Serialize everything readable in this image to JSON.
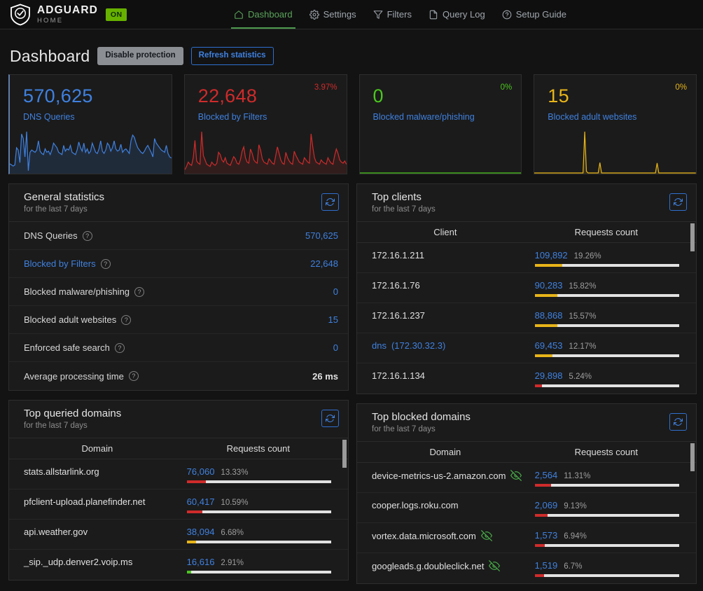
{
  "header": {
    "brand_name": "ADGUARD",
    "brand_sub": "HOME",
    "status_badge": "ON",
    "nav": [
      {
        "label": "Dashboard",
        "icon": "home-icon",
        "active": true
      },
      {
        "label": "Settings",
        "icon": "gear-icon",
        "active": false
      },
      {
        "label": "Filters",
        "icon": "funnel-icon",
        "active": false
      },
      {
        "label": "Query Log",
        "icon": "document-icon",
        "active": false
      },
      {
        "label": "Setup Guide",
        "icon": "question-circle-icon",
        "active": false
      }
    ]
  },
  "page": {
    "title": "Dashboard",
    "disable_protection_label": "Disable protection",
    "refresh_statistics_label": "Refresh statistics"
  },
  "cards": [
    {
      "value": "570,625",
      "label": "DNS Queries",
      "percent": "",
      "color": "#3f81e0",
      "accent": true
    },
    {
      "value": "22,648",
      "label": "Blocked by Filters",
      "percent": "3.97%",
      "color": "#cf2b2b",
      "accent": false
    },
    {
      "value": "0",
      "label": "Blocked malware/phishing",
      "percent": "0%",
      "color": "#4bc61f",
      "accent": false
    },
    {
      "value": "15",
      "label": "Blocked adult websites",
      "percent": "0%",
      "color": "#e8b519",
      "accent": false
    }
  ],
  "general_statistics": {
    "title": "General statistics",
    "subtitle": "for the last 7 days",
    "refresh_icon": "refresh-icon",
    "rows": [
      {
        "name": "DNS Queries",
        "value": "570,625",
        "link": false,
        "bold": false
      },
      {
        "name": "Blocked by Filters",
        "value": "22,648",
        "link": true,
        "bold": false
      },
      {
        "name": "Blocked malware/phishing",
        "value": "0",
        "link": false,
        "bold": false
      },
      {
        "name": "Blocked adult websites",
        "value": "15",
        "link": false,
        "bold": false
      },
      {
        "name": "Enforced safe search",
        "value": "0",
        "link": false,
        "bold": false
      },
      {
        "name": "Average processing time",
        "value": "26 ms",
        "link": false,
        "bold": true
      }
    ]
  },
  "top_clients": {
    "title": "Top clients",
    "subtitle": "for the last 7 days",
    "refresh_icon": "refresh-icon",
    "columns": [
      "Client",
      "Requests count"
    ],
    "rows": [
      {
        "name": "172.16.1.211",
        "name_suffix": "",
        "link": false,
        "count": "109,892",
        "percent": "19.26%",
        "bar_pct": 19.26,
        "bar_color": "#e8b519",
        "eye_off": false
      },
      {
        "name": "172.16.1.76",
        "name_suffix": "",
        "link": false,
        "count": "90,283",
        "percent": "15.82%",
        "bar_pct": 15.82,
        "bar_color": "#e8b519",
        "eye_off": false
      },
      {
        "name": "172.16.1.237",
        "name_suffix": "",
        "link": false,
        "count": "88,868",
        "percent": "15.57%",
        "bar_pct": 15.57,
        "bar_color": "#e8b519",
        "eye_off": false
      },
      {
        "name": "dns",
        "name_suffix": "(172.30.32.3)",
        "link": true,
        "count": "69,453",
        "percent": "12.17%",
        "bar_pct": 12.17,
        "bar_color": "#e8b519",
        "eye_off": false
      },
      {
        "name": "172.16.1.134",
        "name_suffix": "",
        "link": false,
        "count": "29,898",
        "percent": "5.24%",
        "bar_pct": 5.24,
        "bar_color": "#cf2b2b",
        "eye_off": false
      }
    ]
  },
  "top_queried_domains": {
    "title": "Top queried domains",
    "subtitle": "for the last 7 days",
    "refresh_icon": "refresh-icon",
    "columns": [
      "Domain",
      "Requests count"
    ],
    "rows": [
      {
        "name": "stats.allstarlink.org",
        "name_suffix": "",
        "link": false,
        "count": "76,060",
        "percent": "13.33%",
        "bar_pct": 13.33,
        "bar_color": "#cf2b2b",
        "eye_off": false
      },
      {
        "name": "pfclient-upload.planefinder.net",
        "name_suffix": "",
        "link": false,
        "count": "60,417",
        "percent": "10.59%",
        "bar_pct": 10.59,
        "bar_color": "#cf2b2b",
        "eye_off": false
      },
      {
        "name": "api.weather.gov",
        "name_suffix": "",
        "link": false,
        "count": "38,094",
        "percent": "6.68%",
        "bar_pct": 6.68,
        "bar_color": "#e8b519",
        "eye_off": false
      },
      {
        "name": "_sip._udp.denver2.voip.ms",
        "name_suffix": "",
        "link": false,
        "count": "16,616",
        "percent": "2.91%",
        "bar_pct": 2.91,
        "bar_color": "#4bc61f",
        "eye_off": false
      }
    ]
  },
  "top_blocked_domains": {
    "title": "Top blocked domains",
    "subtitle": "for the last 7 days",
    "refresh_icon": "refresh-icon",
    "columns": [
      "Domain",
      "Requests count"
    ],
    "rows": [
      {
        "name": "device-metrics-us-2.amazon.com",
        "name_suffix": "",
        "link": false,
        "count": "2,564",
        "percent": "11.31%",
        "bar_pct": 11.31,
        "bar_color": "#cf2b2b",
        "eye_off": true
      },
      {
        "name": "cooper.logs.roku.com",
        "name_suffix": "",
        "link": false,
        "count": "2,069",
        "percent": "9.13%",
        "bar_pct": 9.13,
        "bar_color": "#cf2b2b",
        "eye_off": false
      },
      {
        "name": "vortex.data.microsoft.com",
        "name_suffix": "",
        "link": false,
        "count": "1,573",
        "percent": "6.94%",
        "bar_pct": 6.94,
        "bar_color": "#cf2b2b",
        "eye_off": true
      },
      {
        "name": "googleads.g.doubleclick.net",
        "name_suffix": "",
        "link": false,
        "count": "1,519",
        "percent": "6.7%",
        "bar_pct": 6.7,
        "bar_color": "#cf2b2b",
        "eye_off": true
      }
    ]
  },
  "chart_data": [
    {
      "type": "area",
      "title": "DNS Queries",
      "color": "#3f81e0",
      "values": [
        8,
        7,
        6,
        7,
        22,
        20,
        9,
        34,
        30,
        14,
        36,
        2,
        18,
        20,
        19,
        18,
        20,
        28,
        19,
        17,
        16,
        21,
        18,
        19,
        16,
        20,
        26,
        24,
        22,
        18,
        17,
        16,
        24,
        19,
        21,
        20,
        24,
        18,
        17,
        16,
        20,
        27,
        22,
        19,
        26,
        18,
        21,
        17,
        19,
        26,
        22,
        18,
        17,
        21,
        28,
        19,
        17,
        20,
        26,
        24,
        19,
        22,
        28,
        21,
        19,
        20,
        25,
        18,
        20,
        21,
        19,
        17,
        28,
        33,
        31,
        26,
        22,
        20,
        18,
        17,
        19,
        22,
        24,
        21,
        18,
        14,
        30,
        26,
        24,
        22,
        20,
        19,
        18,
        24,
        17,
        14,
        13
      ]
    },
    {
      "type": "area",
      "title": "Blocked by Filters",
      "color": "#cf2b2b",
      "values": [
        3,
        6,
        10,
        8,
        7,
        14,
        30,
        11,
        9,
        8,
        38,
        16,
        12,
        8,
        7,
        6,
        10,
        8,
        7,
        9,
        19,
        17,
        12,
        10,
        14,
        9,
        8,
        7,
        11,
        15,
        13,
        9,
        8,
        12,
        20,
        24,
        14,
        10,
        9,
        22,
        18,
        12,
        10,
        9,
        26,
        21,
        13,
        10,
        9,
        8,
        13,
        11,
        9,
        8,
        16,
        24,
        18,
        12,
        9,
        8,
        19,
        14,
        11,
        9,
        8,
        20,
        16,
        13,
        10,
        9,
        8,
        14,
        12,
        10,
        9,
        36,
        24,
        14,
        10,
        9,
        8,
        12,
        10,
        9,
        8,
        14,
        11,
        9,
        8,
        16,
        22,
        18,
        12,
        10,
        9,
        11,
        8
      ]
    },
    {
      "type": "area",
      "title": "Blocked malware/phishing",
      "color": "#4bc61f",
      "values": [
        0,
        0,
        0,
        0,
        0,
        0,
        0,
        0,
        0,
        0,
        0,
        0,
        0,
        0,
        0,
        0,
        0,
        0,
        0,
        0,
        0,
        0,
        0,
        0,
        0,
        0,
        0,
        0,
        0,
        0,
        0,
        0,
        0,
        0,
        0,
        0,
        0,
        0,
        0,
        0,
        0,
        0,
        0,
        0,
        0,
        0,
        0,
        0,
        0,
        0,
        0,
        0,
        0,
        0,
        0,
        0,
        0,
        0,
        0,
        0,
        0,
        0,
        0,
        0,
        0,
        0,
        0,
        0,
        0,
        0,
        0,
        0,
        0,
        0,
        0,
        0,
        0,
        0,
        0,
        0,
        0,
        0,
        0,
        0,
        0,
        0,
        0,
        0,
        0,
        0,
        0,
        0,
        0,
        0,
        0,
        0,
        0
      ]
    },
    {
      "type": "area",
      "title": "Blocked adult websites",
      "color": "#e8b519",
      "values": [
        0,
        0,
        0,
        0,
        0,
        0,
        0,
        0,
        0,
        0,
        0,
        0,
        0,
        0,
        0,
        0,
        0,
        0,
        0,
        0,
        0,
        0,
        0,
        0,
        0,
        0,
        0,
        0,
        0,
        0,
        100,
        4,
        0,
        0,
        0,
        0,
        0,
        0,
        0,
        25,
        0,
        0,
        0,
        0,
        0,
        0,
        0,
        0,
        0,
        0,
        0,
        0,
        0,
        0,
        0,
        0,
        0,
        0,
        0,
        0,
        0,
        0,
        0,
        0,
        0,
        0,
        0,
        0,
        0,
        0,
        0,
        0,
        0,
        24,
        0,
        0,
        0,
        0,
        0,
        0,
        0,
        0,
        0,
        0,
        0,
        0,
        0,
        0,
        0,
        0,
        0,
        0,
        0,
        0,
        0,
        0,
        0
      ]
    }
  ]
}
